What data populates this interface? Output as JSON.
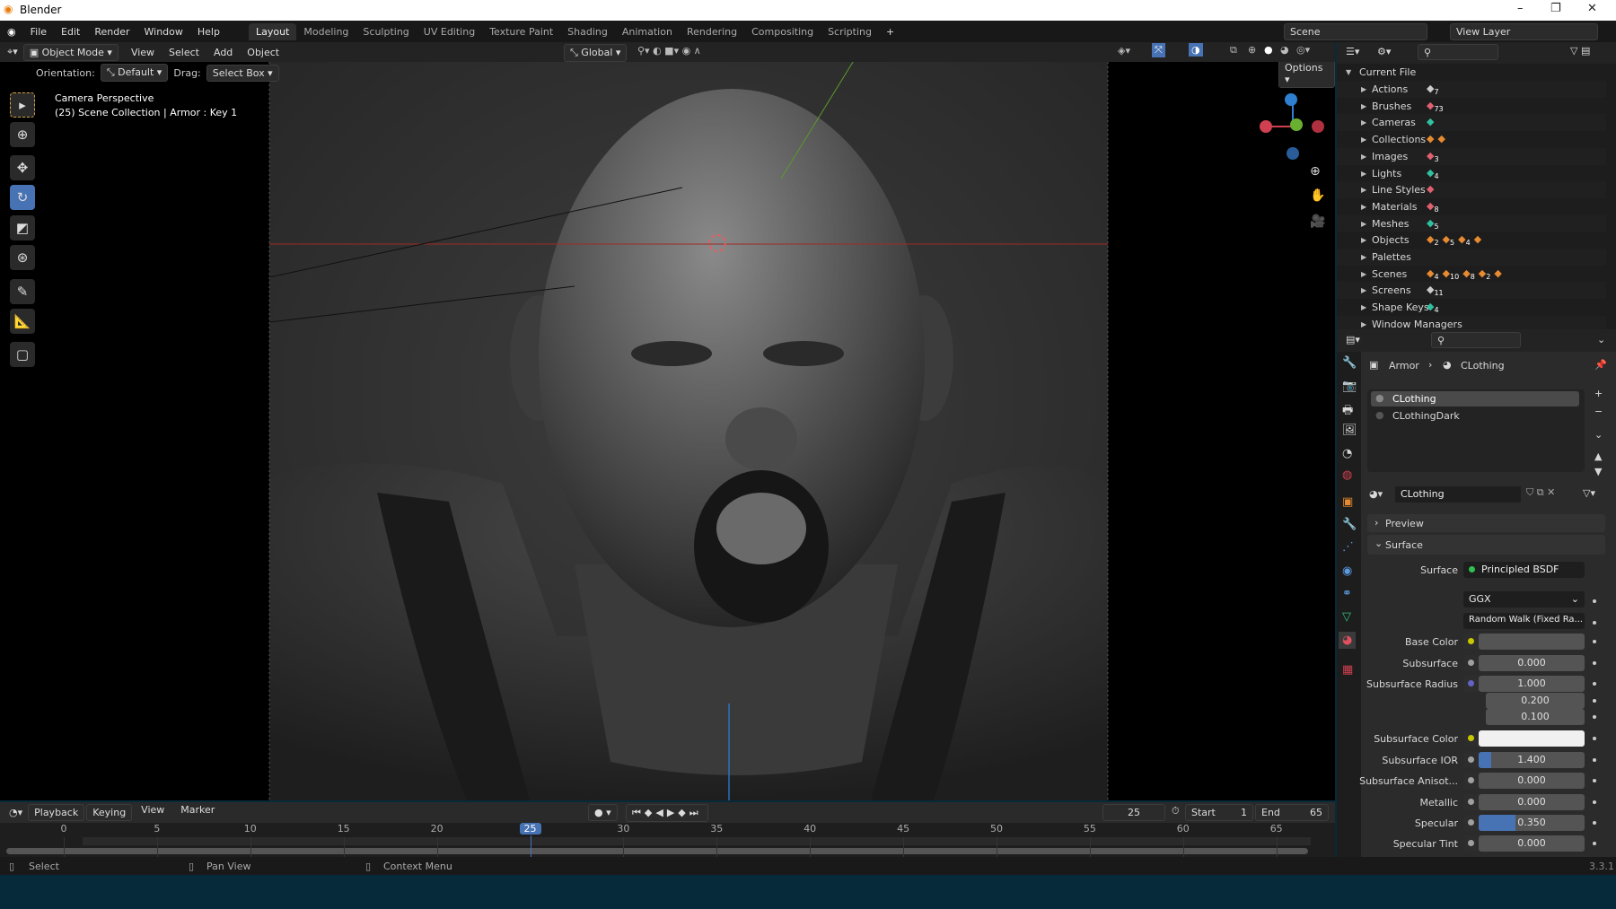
{
  "titlebar": {
    "title": "Blender",
    "minimize": "–",
    "maximize": "❐",
    "close": "✕"
  },
  "menubar": {
    "menus": [
      "File",
      "Edit",
      "Render",
      "Window",
      "Help"
    ],
    "workspaces": [
      "Layout",
      "Modeling",
      "Sculpting",
      "UV Editing",
      "Texture Paint",
      "Shading",
      "Animation",
      "Rendering",
      "Compositing",
      "Scripting"
    ],
    "active_workspace": "Layout",
    "add": "+",
    "scene": "Scene",
    "view_layer": "View Layer"
  },
  "viewport": {
    "mode": "Object Mode",
    "menus": [
      "View",
      "Select",
      "Add",
      "Object"
    ],
    "transform_orientation": "Global",
    "orientation_label": "Orientation:",
    "orientation_value": "Default",
    "drag_label": "Drag:",
    "drag_value": "Select Box",
    "options": "Options",
    "overlay_title": "Camera Perspective",
    "overlay_subtitle": "(25) Scene Collection | Armor : Key 1",
    "gizmo": {
      "x": "X",
      "y": "Y",
      "z": "Z"
    }
  },
  "outliner": {
    "root": "Current File",
    "items": [
      {
        "label": "Actions",
        "counts": [
          "7"
        ]
      },
      {
        "label": "Brushes",
        "counts": [
          "73"
        ]
      },
      {
        "label": "Cameras",
        "counts": [
          ""
        ]
      },
      {
        "label": "Collections",
        "counts": [
          "",
          ""
        ]
      },
      {
        "label": "Images",
        "counts": [
          "3"
        ]
      },
      {
        "label": "Lights",
        "counts": [
          "4"
        ]
      },
      {
        "label": "Line Styles",
        "counts": [
          ""
        ]
      },
      {
        "label": "Materials",
        "counts": [
          "8"
        ]
      },
      {
        "label": "Meshes",
        "counts": [
          "5"
        ]
      },
      {
        "label": "Objects",
        "counts": [
          "2",
          "5",
          "4",
          ""
        ]
      },
      {
        "label": "Palettes",
        "counts": []
      },
      {
        "label": "Scenes",
        "counts": [
          "4",
          "10",
          "8",
          "2",
          ""
        ]
      },
      {
        "label": "Screens",
        "counts": [
          "11"
        ]
      },
      {
        "label": "Shape Keys",
        "counts": [
          "4"
        ]
      },
      {
        "label": "Window Managers",
        "counts": []
      }
    ]
  },
  "properties": {
    "breadcrumb_object": "Armor",
    "breadcrumb_material": "CLothing",
    "slots": [
      "CLothing",
      "CLothingDark"
    ],
    "material_name": "CLothing",
    "preview": "Preview",
    "surface_panel": "Surface",
    "surface_label": "Surface",
    "surface_value": "Principled BSDF",
    "distribution": "GGX",
    "subsurface_method": "Random Walk (Fixed Ra...",
    "rows": [
      {
        "label": "Base Color",
        "value": "",
        "dot": "#c8c800",
        "fill": 0
      },
      {
        "label": "Subsurface",
        "value": "0.000",
        "dot": "#a0a0a0",
        "fill": 0
      },
      {
        "label": "Subsurface Radius",
        "value": "1.000",
        "dot": "#6363c7",
        "fill": 0
      },
      {
        "label": "",
        "value": "0.200",
        "dot": "",
        "fill": 0
      },
      {
        "label": "",
        "value": "0.100",
        "dot": "",
        "fill": 0
      },
      {
        "label": "Subsurface Color",
        "value": "",
        "dot": "#c8c800",
        "fill": 0,
        "color": "#f0f0f0"
      },
      {
        "label": "Subsurface IOR",
        "value": "1.400",
        "dot": "#a0a0a0",
        "fill": 0.12
      },
      {
        "label": "Subsurface Anisot...",
        "value": "0.000",
        "dot": "#a0a0a0",
        "fill": 0
      },
      {
        "label": "Metallic",
        "value": "0.000",
        "dot": "#a0a0a0",
        "fill": 0
      },
      {
        "label": "Specular",
        "value": "0.350",
        "dot": "#a0a0a0",
        "fill": 0.35
      },
      {
        "label": "Specular Tint",
        "value": "0.000",
        "dot": "#a0a0a0",
        "fill": 0
      }
    ]
  },
  "timeline": {
    "menus": [
      "Playback",
      "Keying",
      "View",
      "Marker"
    ],
    "current_frame": "25",
    "start_label": "Start",
    "start": "1",
    "end_label": "End",
    "end": "65",
    "ticks": [
      "0",
      "5",
      "10",
      "15",
      "20",
      "25",
      "30",
      "35",
      "40",
      "45",
      "50",
      "55",
      "60",
      "65"
    ]
  },
  "statusbar": {
    "select": "Select",
    "pan": "Pan View",
    "context": "Context Menu",
    "version": "3.3.1"
  },
  "colors": {
    "accent": "#4772b3",
    "header": "#232323",
    "panel": "#2b2b2b"
  }
}
